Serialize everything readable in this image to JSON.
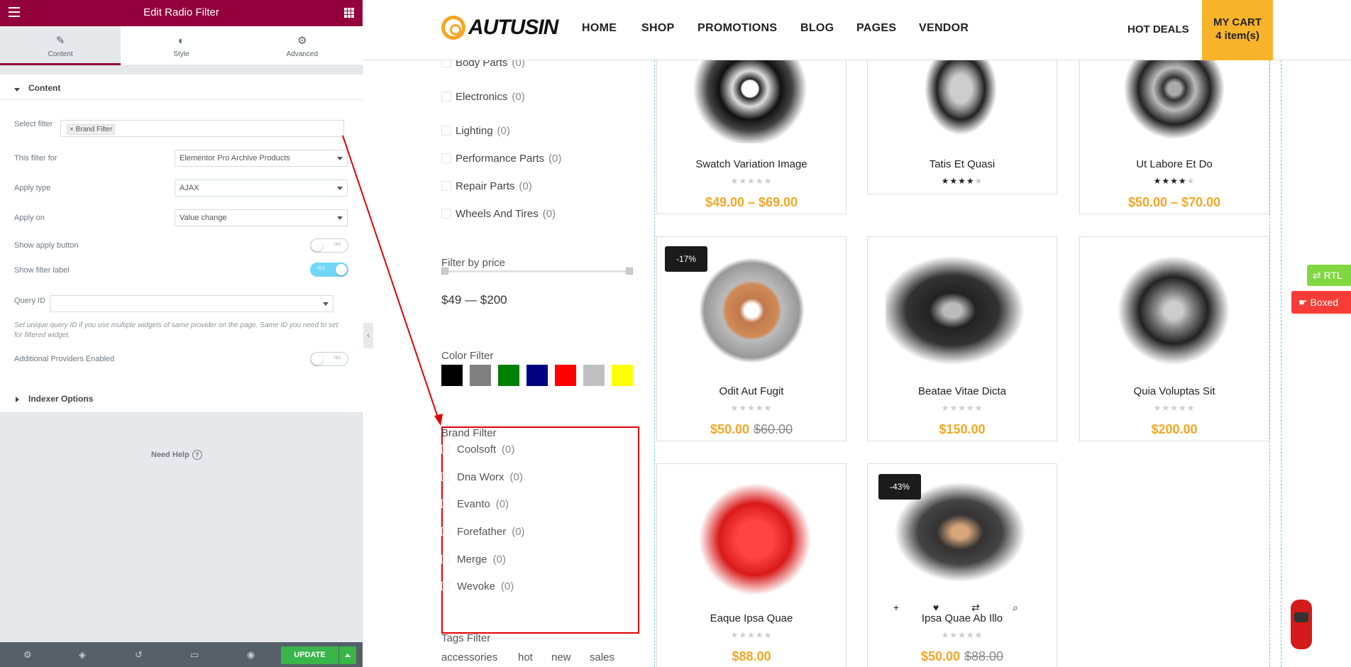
{
  "editor": {
    "title": "Edit Radio Filter",
    "tabs": [
      {
        "label": "Content",
        "icon": "pencil-icon"
      },
      {
        "label": "Style",
        "icon": "contrast-icon"
      },
      {
        "label": "Advanced",
        "icon": "gear-icon"
      }
    ],
    "content_section": "Content",
    "select_filter_label": "Select filter",
    "select_filter_tag": "Brand Filter",
    "filter_for_label": "This filter for",
    "filter_for_value": "Elementor Pro Archive Products",
    "apply_type_label": "Apply type",
    "apply_type_value": "AJAX",
    "apply_on_label": "Apply on",
    "apply_on_value": "Value change",
    "show_apply_label": "Show apply button",
    "show_apply_state": "NO",
    "show_filter_label": "Show filter label",
    "show_filter_state": "YES",
    "query_id_label": "Query ID",
    "query_id_hint": "Set unique query ID if you use multiple widgets of same provider on the page. Same ID you need to set for filtered widget.",
    "additional_label": "Additional Providers Enabled",
    "additional_state": "NO",
    "indexer_section": "Indexer Options",
    "need_help": "Need Help",
    "update_label": "UPDATE"
  },
  "site": {
    "logo": "AUTUSIN",
    "nav": [
      "HOME",
      "SHOP",
      "PROMOTIONS",
      "BLOG",
      "PAGES",
      "VENDOR"
    ],
    "hot_deals": "HOT DEALS",
    "cart_title": "MY CART",
    "cart_items": "4 item(s)"
  },
  "categories": [
    {
      "name": "Body Parts",
      "count": "(0)"
    },
    {
      "name": "Electronics",
      "count": "(0)"
    },
    {
      "name": "Lighting",
      "count": "(0)"
    },
    {
      "name": "Performance Parts",
      "count": "(0)"
    },
    {
      "name": "Repair Parts",
      "count": "(0)"
    },
    {
      "name": "Wheels And Tires",
      "count": "(0)"
    }
  ],
  "price_filter": {
    "title": "Filter by price",
    "range": "$49 — $200"
  },
  "color_filter": {
    "title": "Color Filter",
    "colors": [
      "#000000",
      "#808080",
      "#008000",
      "#000080",
      "#ff0000",
      "#c0c0c0",
      "#ffff00"
    ]
  },
  "brand_filter": {
    "title": "Brand Filter",
    "brands": [
      {
        "name": "Coolsoft",
        "count": "(0)"
      },
      {
        "name": "Dna Worx",
        "count": "(0)"
      },
      {
        "name": "Evanto",
        "count": "(0)"
      },
      {
        "name": "Forefather",
        "count": "(0)"
      },
      {
        "name": "Merge",
        "count": "(0)"
      },
      {
        "name": "Wevoke",
        "count": "(0)"
      }
    ]
  },
  "tags_filter": {
    "title": "Tags Filter",
    "tags": [
      "accessories",
      "hot",
      "new",
      "sales"
    ]
  },
  "products": [
    {
      "name": "Swatch Variation Image",
      "rating": 0,
      "price": "$49.00 – $69.00",
      "old": "",
      "badge": ""
    },
    {
      "name": "Tatis Et Quasi",
      "rating": 4,
      "price": "",
      "old": "",
      "badge": ""
    },
    {
      "name": "Ut Labore Et Do",
      "rating": 4,
      "price": "$50.00 – $70.00",
      "old": "",
      "badge": ""
    },
    {
      "name": "Odit Aut Fugit",
      "rating": 0,
      "price": "$50.00",
      "old": "$60.00",
      "badge": "-17%"
    },
    {
      "name": "Beatae Vitae Dicta",
      "rating": 0,
      "price": "$150.00",
      "old": "",
      "badge": ""
    },
    {
      "name": "Quia Voluptas Sit",
      "rating": 0,
      "price": "$200.00",
      "old": "",
      "badge": ""
    },
    {
      "name": "Eaque Ipsa Quae",
      "rating": 0,
      "price": "$88.00",
      "old": "",
      "badge": ""
    },
    {
      "name": "Ipsa Quae Ab Illo",
      "rating": 0,
      "price": "$50.00",
      "old": "$88.00",
      "badge": "-43%"
    }
  ],
  "side_buttons": {
    "rtl": "RTL",
    "boxed": "Boxed"
  }
}
